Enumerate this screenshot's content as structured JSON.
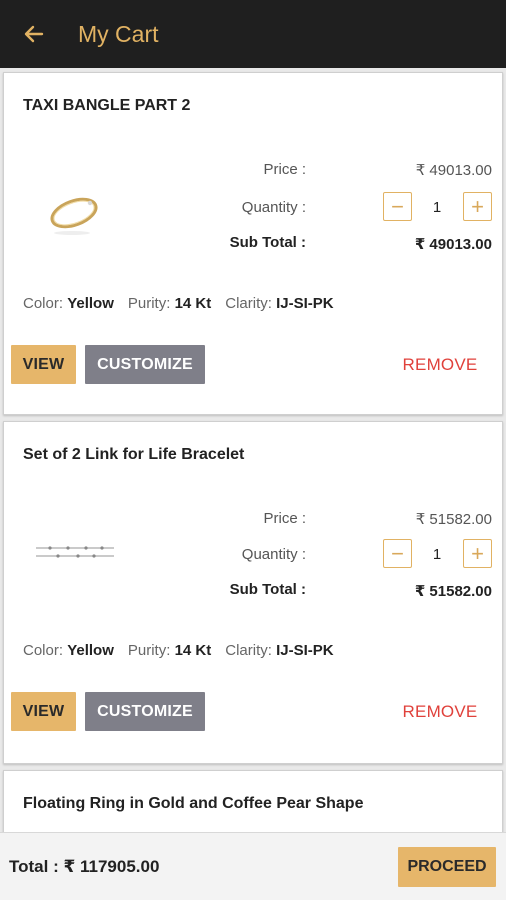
{
  "header": {
    "title": "My Cart",
    "back_icon": "arrow-left-icon"
  },
  "labels": {
    "price": "Price :",
    "quantity": "Quantity :",
    "subtotal": "Sub Total :",
    "color": "Color:",
    "purity": "Purity:",
    "clarity": "Clarity:"
  },
  "buttons": {
    "view": "VIEW",
    "customize": "CUSTOMIZE",
    "remove": "REMOVE",
    "minus": "−",
    "plus": "+"
  },
  "items": [
    {
      "title": "TAXI BANGLE PART 2",
      "price": "₹ 49013.00",
      "quantity": "1",
      "subtotal": "₹ 49013.00",
      "color": "Yellow",
      "purity": "14 Kt",
      "clarity": "IJ-SI-PK"
    },
    {
      "title": "Set of 2 Link for Life Bracelet",
      "price": "₹ 51582.00",
      "quantity": "1",
      "subtotal": "₹ 51582.00",
      "color": "Yellow",
      "purity": "14 Kt",
      "clarity": "IJ-SI-PK"
    },
    {
      "title": "Floating Ring in Gold and Coffee Pear Shape"
    }
  ],
  "footer": {
    "total": "Total :  ₹ 117905.00",
    "proceed": "PROCEED"
  },
  "colors": {
    "appbar": "#1f1f1f",
    "accent": "#e1b263",
    "button_gold": "#e6b66a",
    "button_gray": "#7f7f89",
    "remove_red": "#e0413b"
  }
}
